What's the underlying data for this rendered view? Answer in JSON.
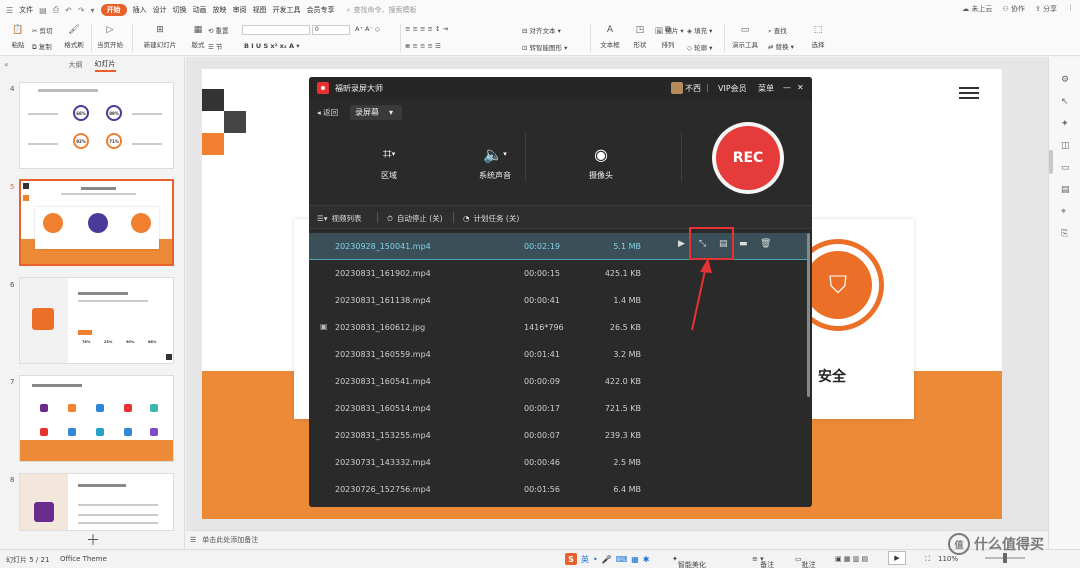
{
  "menubar": {
    "file_label": "文件",
    "items": [
      "开始",
      "插入",
      "设计",
      "切换",
      "动画",
      "放映",
      "审阅",
      "视图",
      "开发工具",
      "会员专享"
    ],
    "active": "开始",
    "search_placeholder": "查找命令、搜索模板",
    "cloud_label": "未上云",
    "collab_label": "协作",
    "share_label": "分享"
  },
  "ribbon": {
    "paste": "粘贴",
    "cut": "剪切",
    "copy": "复制",
    "format_painter": "格式刷",
    "from_current": "当页开始",
    "new_slide": "新建幻灯片",
    "layout": "版式",
    "section": "节",
    "reset": "重置",
    "font_size": "0",
    "align_text": "对齐文本",
    "smartart": "转智能图形",
    "textbox": "文本框",
    "shape": "形状",
    "arrange": "排列",
    "image": "图片",
    "fill": "填充",
    "outline": "轮廓",
    "presentation_tools": "演示工具",
    "find": "查找",
    "replace": "替换",
    "select": "选择"
  },
  "left_panel": {
    "tab_outline": "大纲",
    "tab_slides": "幻灯片",
    "slide_numbers": [
      "4",
      "5",
      "6",
      "7",
      "8"
    ],
    "thumb4": {
      "rings": [
        "68%",
        "89%",
        "92%",
        "71%"
      ]
    },
    "thumb6": {
      "stats": [
        "78%",
        "23%",
        "90%",
        "88%"
      ]
    }
  },
  "slide": {
    "label_safety": "安全"
  },
  "notes_placeholder": "单击此处添加备注",
  "status": {
    "slide_counter": "幻灯片 5 / 21",
    "theme": "Office Theme",
    "ime": "英",
    "smart_beautify": "智能美化",
    "notes": "备注",
    "comments": "批注",
    "zoom": "110%"
  },
  "watermark": {
    "text": "什么值得买",
    "logo": "值"
  },
  "recorder": {
    "title": "福昕录屏大师",
    "user": "不西",
    "vip": "VIP会员",
    "menu": "菜单",
    "back": "返回",
    "mode": "录屏幕",
    "tools": [
      {
        "icon": "crop-icon",
        "label": "区域"
      },
      {
        "icon": "speaker-icon",
        "label": "系统声音"
      },
      {
        "icon": "webcam-icon",
        "label": "摄像头"
      }
    ],
    "rec_label": "REC",
    "bar": {
      "video_list": "视频列表",
      "auto_stop": "自动停止 (关)",
      "schedule": "计划任务 (关)"
    },
    "files": [
      {
        "name": "20230928_150041.mp4",
        "duration": "00:02:19",
        "size": "5.1 MB",
        "selected": true
      },
      {
        "name": "20230831_161902.mp4",
        "duration": "00:00:15",
        "size": "425.1 KB"
      },
      {
        "name": "20230831_161138.mp4",
        "duration": "00:00:41",
        "size": "1.4 MB"
      },
      {
        "name": "20230831_160612.jpg",
        "duration": "1416*796",
        "size": "26.5 KB",
        "image": true
      },
      {
        "name": "20230831_160559.mp4",
        "duration": "00:01:41",
        "size": "3.2 MB"
      },
      {
        "name": "20230831_160541.mp4",
        "duration": "00:00:09",
        "size": "422.0 KB"
      },
      {
        "name": "20230831_160514.mp4",
        "duration": "00:00:17",
        "size": "721.5 KB"
      },
      {
        "name": "20230831_153255.mp4",
        "duration": "00:00:07",
        "size": "239.3 KB"
      },
      {
        "name": "20230731_143332.mp4",
        "duration": "00:00:46",
        "size": "2.5 MB"
      },
      {
        "name": "20230726_152756.mp4",
        "duration": "00:01:56",
        "size": "6.4 MB"
      }
    ]
  },
  "colors": {
    "accent": "#e8602c",
    "rec_red": "#e63b3b",
    "slide_orange": "#ec8a38",
    "highlight_box": "#e53232",
    "selected_row_text": "#7fd3e8"
  }
}
